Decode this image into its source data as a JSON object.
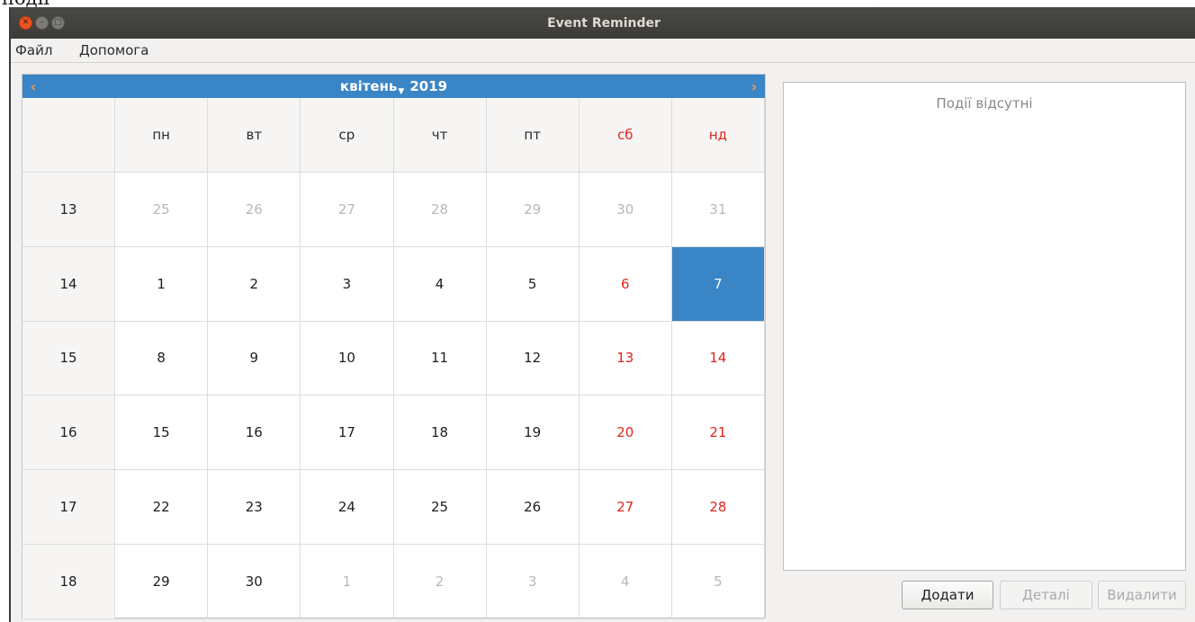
{
  "clipped_text": "події",
  "window": {
    "title": "Event Reminder"
  },
  "menu": {
    "file": "Файл",
    "help": "Допомога"
  },
  "calendar": {
    "prev_label": "‹",
    "next_label": "›",
    "month": "квітень",
    "year": "2019",
    "weekday_headers": [
      "пн",
      "вт",
      "ср",
      "чт",
      "пт",
      "сб",
      "нд"
    ],
    "weekend_color": "#e0251d",
    "selection_color": "#3a85c6",
    "selected_day": "7",
    "weeks": [
      {
        "week": "13",
        "days": [
          "25",
          "26",
          "27",
          "28",
          "29",
          "30",
          "31"
        ],
        "other_month": [
          true,
          true,
          true,
          true,
          true,
          true,
          true
        ]
      },
      {
        "week": "14",
        "days": [
          "1",
          "2",
          "3",
          "4",
          "5",
          "6",
          "7"
        ],
        "other_month": [
          false,
          false,
          false,
          false,
          false,
          false,
          false
        ]
      },
      {
        "week": "15",
        "days": [
          "8",
          "9",
          "10",
          "11",
          "12",
          "13",
          "14"
        ],
        "other_month": [
          false,
          false,
          false,
          false,
          false,
          false,
          false
        ]
      },
      {
        "week": "16",
        "days": [
          "15",
          "16",
          "17",
          "18",
          "19",
          "20",
          "21"
        ],
        "other_month": [
          false,
          false,
          false,
          false,
          false,
          false,
          false
        ]
      },
      {
        "week": "17",
        "days": [
          "22",
          "23",
          "24",
          "25",
          "26",
          "27",
          "28"
        ],
        "other_month": [
          false,
          false,
          false,
          false,
          false,
          false,
          false
        ]
      },
      {
        "week": "18",
        "days": [
          "29",
          "30",
          "1",
          "2",
          "3",
          "4",
          "5"
        ],
        "other_month": [
          false,
          false,
          true,
          true,
          true,
          true,
          true
        ]
      }
    ]
  },
  "events": {
    "empty_text": "Події відсутні"
  },
  "buttons": {
    "add": "Додати",
    "details": "Деталі",
    "delete": "Видалити"
  }
}
